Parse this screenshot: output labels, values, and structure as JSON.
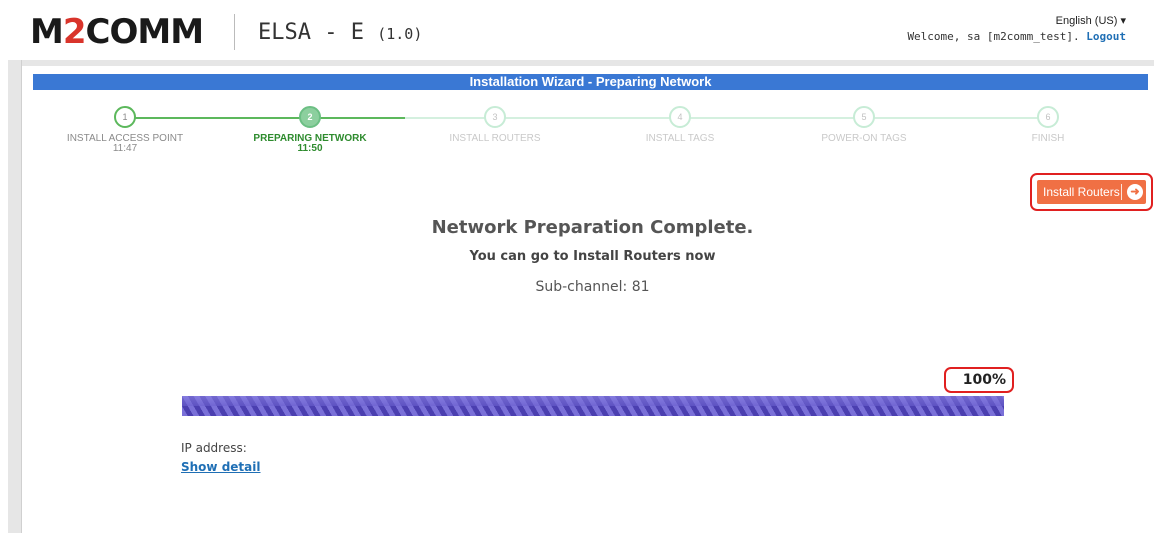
{
  "header": {
    "logo_left": "M",
    "logo_accent": "2",
    "logo_right": "COMM",
    "app_title": "ELSA - E",
    "app_version": "(1.0)",
    "language": "English (US)",
    "language_caret": "▾",
    "welcome_text": "Welcome, sa [m2comm_test].",
    "logout_label": "Logout"
  },
  "wizard": {
    "title": "Installation Wizard - Preparing Network",
    "steps": [
      {
        "number": "1",
        "label": "INSTALL ACCESS POINT",
        "time": "11:47",
        "state": "done"
      },
      {
        "number": "2",
        "label": "PREPARING NETWORK",
        "time": "11:50",
        "state": "active"
      },
      {
        "number": "3",
        "label": "INSTALL ROUTERS",
        "time": "",
        "state": "future"
      },
      {
        "number": "4",
        "label": "INSTALL TAGS",
        "time": "",
        "state": "future"
      },
      {
        "number": "5",
        "label": "POWER-ON TAGS",
        "time": "",
        "state": "future"
      },
      {
        "number": "6",
        "label": "FINISH",
        "time": "",
        "state": "future"
      }
    ],
    "next_button_label": "Install Routers",
    "next_button_icon": "arrow-right-circle-icon"
  },
  "status": {
    "heading": "Network Preparation Complete.",
    "subtext": "You can go to Install Routers now",
    "subchannel": "Sub-channel: 81",
    "progress_percent_label": "100%",
    "progress_fraction": 1.0,
    "ip_label": "IP address:",
    "show_detail_label": "Show detail"
  },
  "colors": {
    "wizard_bar": "#3a78d4",
    "button": "#f07044",
    "active_step": "#2e8b2e",
    "progress": "#4b3fb0",
    "link": "#1f6fb5",
    "highlight": "#e02020"
  }
}
